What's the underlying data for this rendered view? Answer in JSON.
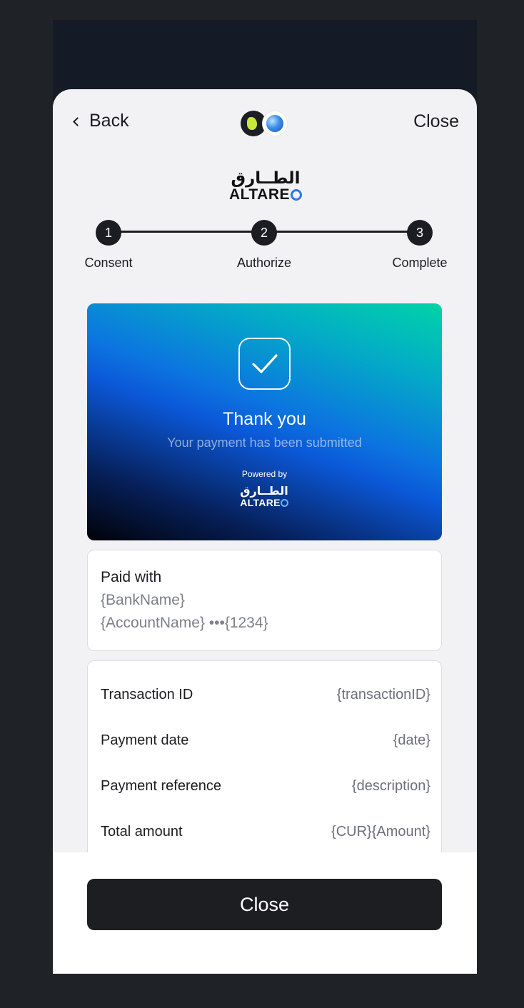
{
  "header": {
    "back_label": "Back",
    "close_label": "Close"
  },
  "brand": {
    "arabic": "الطــارق",
    "latin": "ALTARE"
  },
  "stepper": {
    "steps": [
      {
        "number": "1",
        "label": "Consent"
      },
      {
        "number": "2",
        "label": "Authorize"
      },
      {
        "number": "3",
        "label": "Complete"
      }
    ]
  },
  "hero": {
    "title": "Thank you",
    "subtitle": "Your payment has been submitted",
    "powered_by": "Powered by",
    "brand_arabic": "الطــارق",
    "brand_latin": "ALTARE"
  },
  "paid_with": {
    "title": "Paid with",
    "bank": "{BankName}",
    "account": "{AccountName} •••{1234}"
  },
  "details": {
    "rows": [
      {
        "label": "Transaction ID",
        "value": "{transactionID}"
      },
      {
        "label": "Payment date",
        "value": "{date}"
      },
      {
        "label": "Payment reference",
        "value": "{description}"
      },
      {
        "label": "Total amount",
        "value": "{CUR}{Amount}"
      }
    ]
  },
  "footer": {
    "close_label": "Close"
  }
}
